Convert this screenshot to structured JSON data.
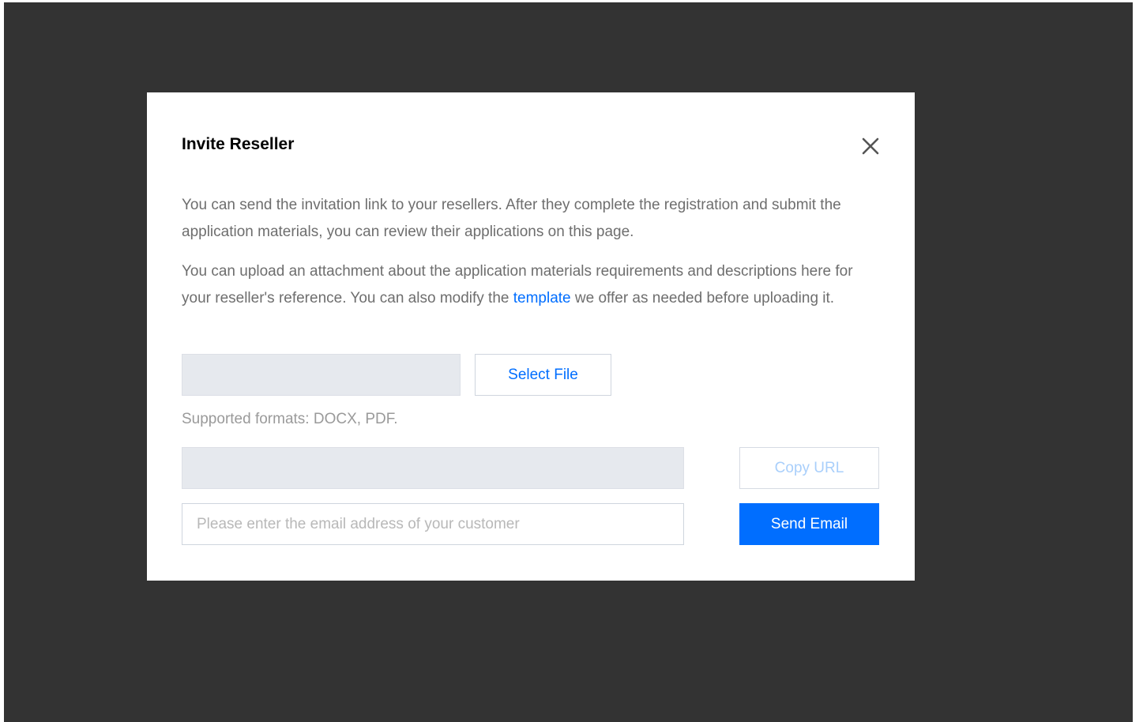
{
  "dialog": {
    "title": "Invite Reseller",
    "close_icon": "close-icon",
    "description_1": "You can send the invitation link to your resellers. After they complete the registration and submit the application materials, you can review their applications on this page.",
    "description_2_before_link": "You can upload an attachment about the application materials requirements and descriptions here for your reseller's reference. You can also modify the ",
    "description_2_link": "template",
    "description_2_after_link": " we offer as needed before uploading it.",
    "file_field_value": "",
    "select_file_label": "Select File",
    "supported_formats": "Supported formats: DOCX, PDF.",
    "url_field_value": "",
    "copy_url_label": "Copy URL",
    "email_placeholder": "Please enter the email address of your customer",
    "email_value": "",
    "send_email_label": "Send Email"
  },
  "colors": {
    "overlay": "#333333",
    "accent": "#006eff",
    "disabled_text": "#a9cffb",
    "readonly_field": "#e6e9ee",
    "body_text": "#6e6e6e"
  }
}
